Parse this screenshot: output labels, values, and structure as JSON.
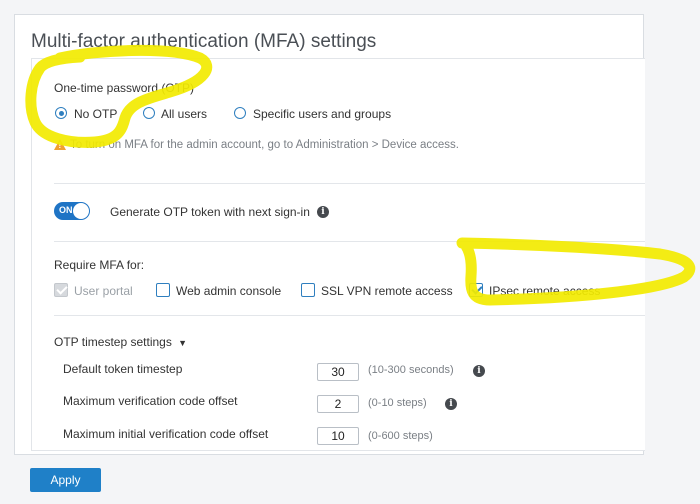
{
  "panel": {
    "title": "Multi-factor authentication (MFA) settings"
  },
  "otp": {
    "heading": "One-time password (OTP)",
    "options": [
      {
        "label": "No OTP",
        "checked": true
      },
      {
        "label": "All users",
        "checked": false
      },
      {
        "label": "Specific users and groups",
        "checked": false
      }
    ],
    "warning": "To turn on MFA for the admin account, go to Administration > Device access."
  },
  "generate": {
    "toggle_text": "ON",
    "label": "Generate OTP token with next sign-in",
    "info_icon": "info-icon"
  },
  "require": {
    "heading": "Require MFA for:",
    "items": [
      {
        "label": "User portal",
        "checked": true,
        "disabled": true
      },
      {
        "label": "Web admin console",
        "checked": false
      },
      {
        "label": "SSL VPN remote access",
        "checked": false
      },
      {
        "label": "IPsec remote access",
        "checked": true
      }
    ]
  },
  "timestep": {
    "heading": "OTP timestep settings",
    "rows": [
      {
        "label": "Default token timestep",
        "value": "30",
        "hint": "(10-300 seconds)"
      },
      {
        "label": "Maximum verification code offset",
        "value": "2",
        "hint": "(0-10 steps)"
      },
      {
        "label": "Maximum initial verification code offset",
        "value": "10",
        "hint": "(0-600 steps)"
      }
    ]
  },
  "actions": {
    "apply_label": "Apply"
  },
  "colors": {
    "accent": "#1f80c8",
    "highlight": "#f2ea00",
    "warning": "#f0a032"
  }
}
